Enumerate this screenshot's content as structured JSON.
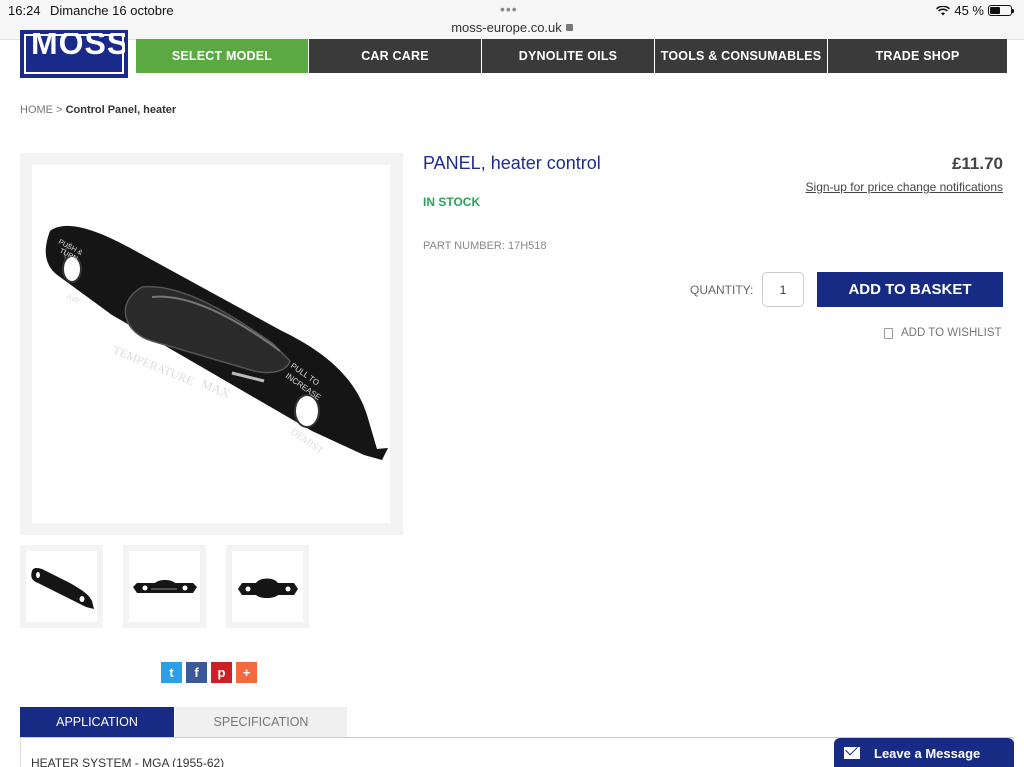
{
  "status_bar": {
    "time": "16:24",
    "date": "Dimanche 16 octobre",
    "url": "moss-europe.co.uk",
    "battery": "45 %",
    "dots": "•••"
  },
  "logo": {
    "text": "MOSS"
  },
  "nav": {
    "items": [
      {
        "label": "SELECT MODEL",
        "active": true
      },
      {
        "label": "CAR CARE"
      },
      {
        "label": "DYNOLITE OILS"
      },
      {
        "label": "TOOLS & CONSUMABLES"
      },
      {
        "label": "TRADE SHOP"
      }
    ]
  },
  "breadcrumb": {
    "home": "HOME",
    "separator": ">",
    "current": "Control Panel, heater"
  },
  "product": {
    "title": "PANEL, heater control",
    "price": "£11.70",
    "price_notify": "Sign-up for price change notifications",
    "stock": "IN STOCK",
    "part_number": "PART NUMBER: 17H518",
    "quantity_label": "QUANTITY:",
    "quantity_value": "1",
    "add_to_basket": "ADD TO BASKET",
    "add_to_wishlist": "ADD TO WISHLIST",
    "image_text": {
      "push_turn_1": "PUSH &",
      "push_turn_2": "TURN",
      "air": "AIR",
      "temperature": "TEMPERATURE",
      "max": "MAX",
      "pull_1": "PULL TO",
      "pull_2": "INCREASE",
      "demist": "DEMIST"
    }
  },
  "share": {
    "twitter": "t",
    "facebook": "f",
    "pinterest": "p",
    "more": "+"
  },
  "tabs": {
    "application": "APPLICATION",
    "specification": "SPECIFICATION",
    "panel_text": "HEATER SYSTEM - MGA (1955-62)"
  },
  "chat": {
    "label": "Leave a Message"
  },
  "colors": {
    "brand_blue": "#172a84",
    "nav_active": "#5aa943",
    "nav_dark": "#3a3a3a",
    "stock_green": "#2aa356"
  }
}
